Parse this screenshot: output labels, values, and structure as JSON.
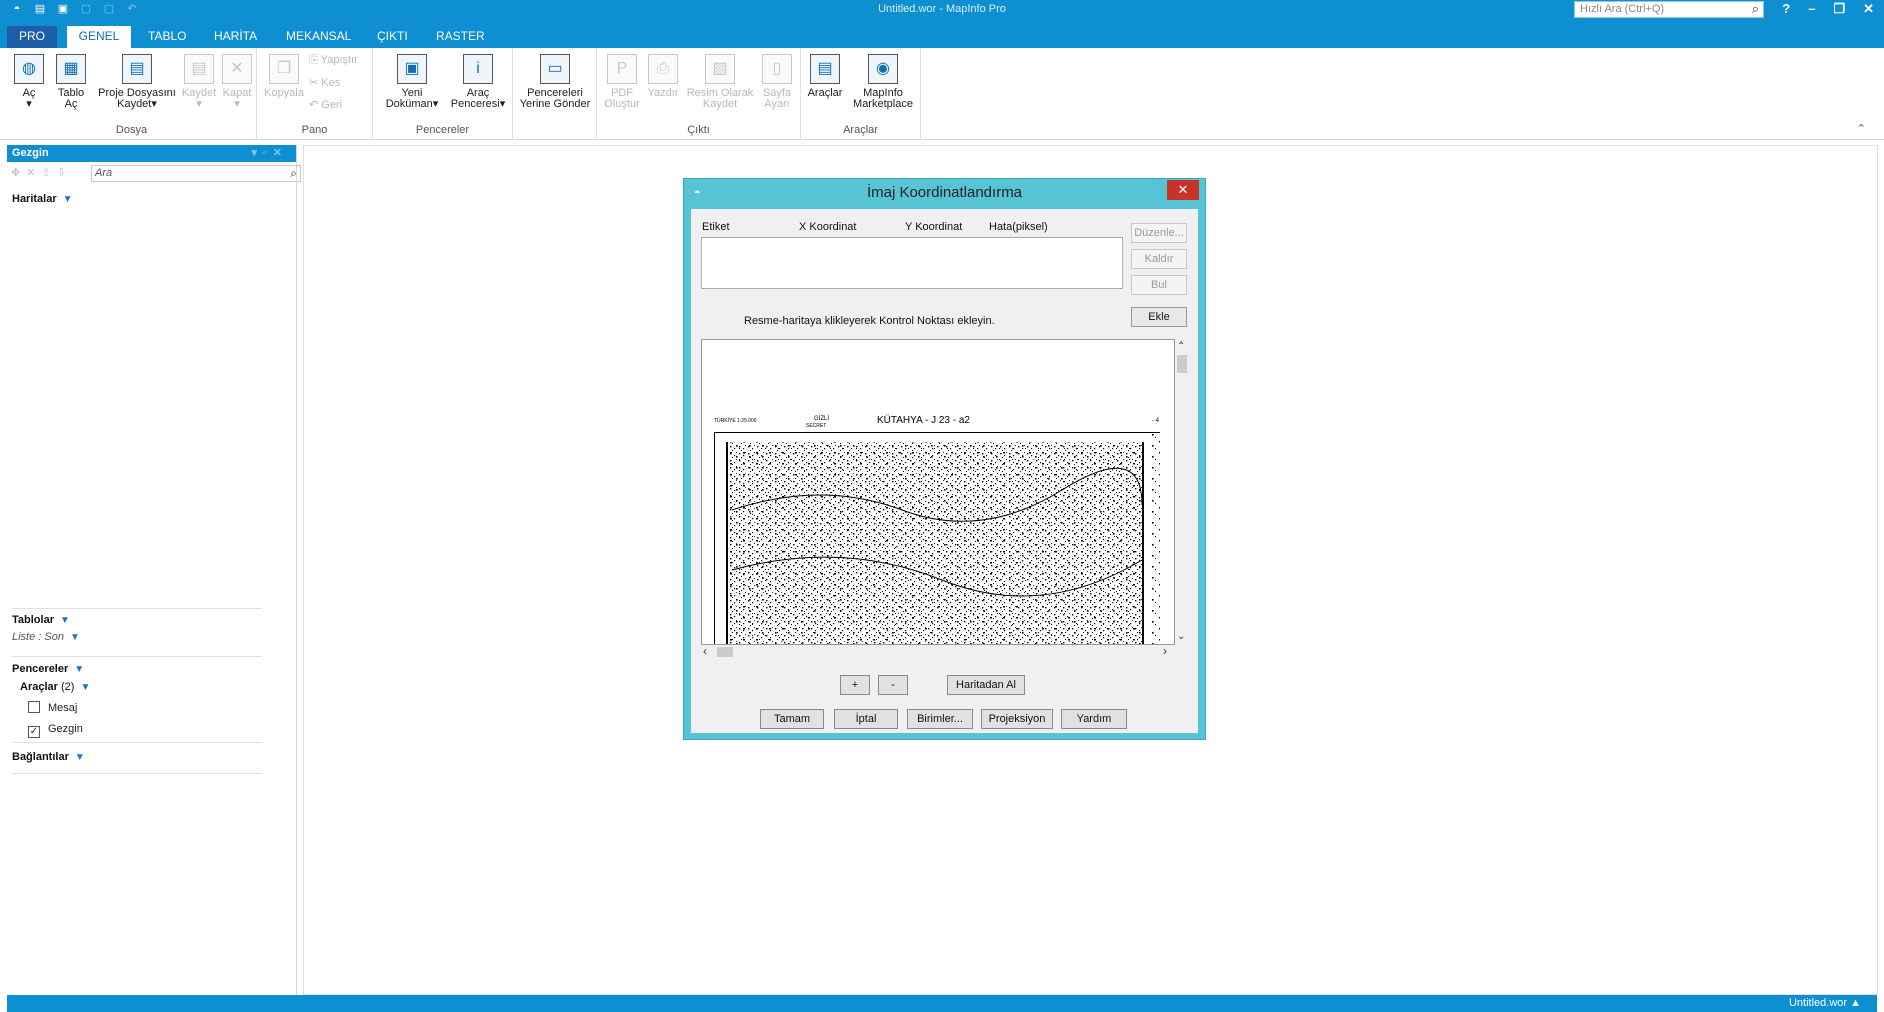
{
  "titlebar": {
    "title": "Untitled.wor - MapInfo Pro",
    "search_placeholder": "Hızlı Ara (Ctrl+Q)",
    "help": "?",
    "minimize": "–",
    "restore": "❐",
    "close": "✕"
  },
  "tabs": {
    "pro": "PRO",
    "genel": "GENEL",
    "tablo": "TABLO",
    "harita": "HARİTA",
    "mekansal": "MEKANSAL",
    "cikti": "ÇIKTI",
    "raster": "RASTER"
  },
  "ribbon": {
    "dosya": {
      "label": "Dosya",
      "ac": "Aç",
      "tablo_ac_1": "Tablo",
      "tablo_ac_2": "Aç",
      "proje_1": "Proje Dosyasını",
      "proje_2": "Kaydet",
      "kaydet": "Kaydet",
      "kapat": "Kapat"
    },
    "pano": {
      "label": "Pano",
      "kopyala": "Kopyala",
      "yapistir": "Yapıştır",
      "kes": "Kes",
      "geri": "Geri"
    },
    "pencereler": {
      "label": "Pencereler",
      "yeni_1": "Yeni",
      "yeni_2": "Doküman",
      "arac_1": "Araç",
      "arac_2": "Penceresi",
      "yerine_1": "Pencereleri",
      "yerine_2": "Yerine Gönder"
    },
    "cikti": {
      "label": "Çıktı",
      "pdf_1": "PDF",
      "pdf_2": "Oluştur",
      "yazdir": "Yazdır",
      "resim_1": "Resim Olarak",
      "resim_2": "Kaydet",
      "sayfa_1": "Sayfa",
      "sayfa_2": "Ayarı"
    },
    "araclar": {
      "label": "Araçlar",
      "araclar": "Araçlar",
      "market_1": "MapInfo",
      "market_2": "Marketplace"
    }
  },
  "navigator": {
    "title": "Gezgin",
    "search_placeholder": "Ara",
    "haritalar": "Haritalar",
    "tablolar": "Tablolar",
    "liste": "Liste : Son",
    "pencereler": "Pencereler",
    "araclar": "Araçlar",
    "araclar_count": "(2)",
    "mesaj": "Mesaj",
    "gezgin": "Gezgin",
    "mesaj_checked": false,
    "gezgin_checked": true,
    "baglantilar": "Bağlantılar"
  },
  "dialog": {
    "title": "İmaj Koordinatlandırma",
    "columns": {
      "etiket": "Etiket",
      "x": "X Koordinat",
      "y": "Y Koordinat",
      "hata": "Hata(piksel)"
    },
    "side_buttons": {
      "duzenle": "Düzenle...",
      "kaldir": "Kaldır",
      "bul": "Bul",
      "ekle": "Ekle"
    },
    "instruction": "Resme-haritaya klikleyerek Kontrol Noktası ekleyin.",
    "map_header": {
      "left": "TÜRKİYE 1:25.000",
      "gizli_1": "GİZLİ",
      "gizli_2": "SECRET",
      "center": "KÜTAHYA - J 23 - a2",
      "right": "- 4"
    },
    "zoom_in": "+",
    "zoom_out": "-",
    "haritadan_al": "Haritadan Al",
    "buttons": {
      "tamam": "Tamam",
      "iptal": "İptal",
      "birimler": "Birimler...",
      "projeksiyon": "Projeksiyon",
      "yardim": "Yardım"
    }
  },
  "statusbar": {
    "workspace": "Untitled.wor"
  }
}
